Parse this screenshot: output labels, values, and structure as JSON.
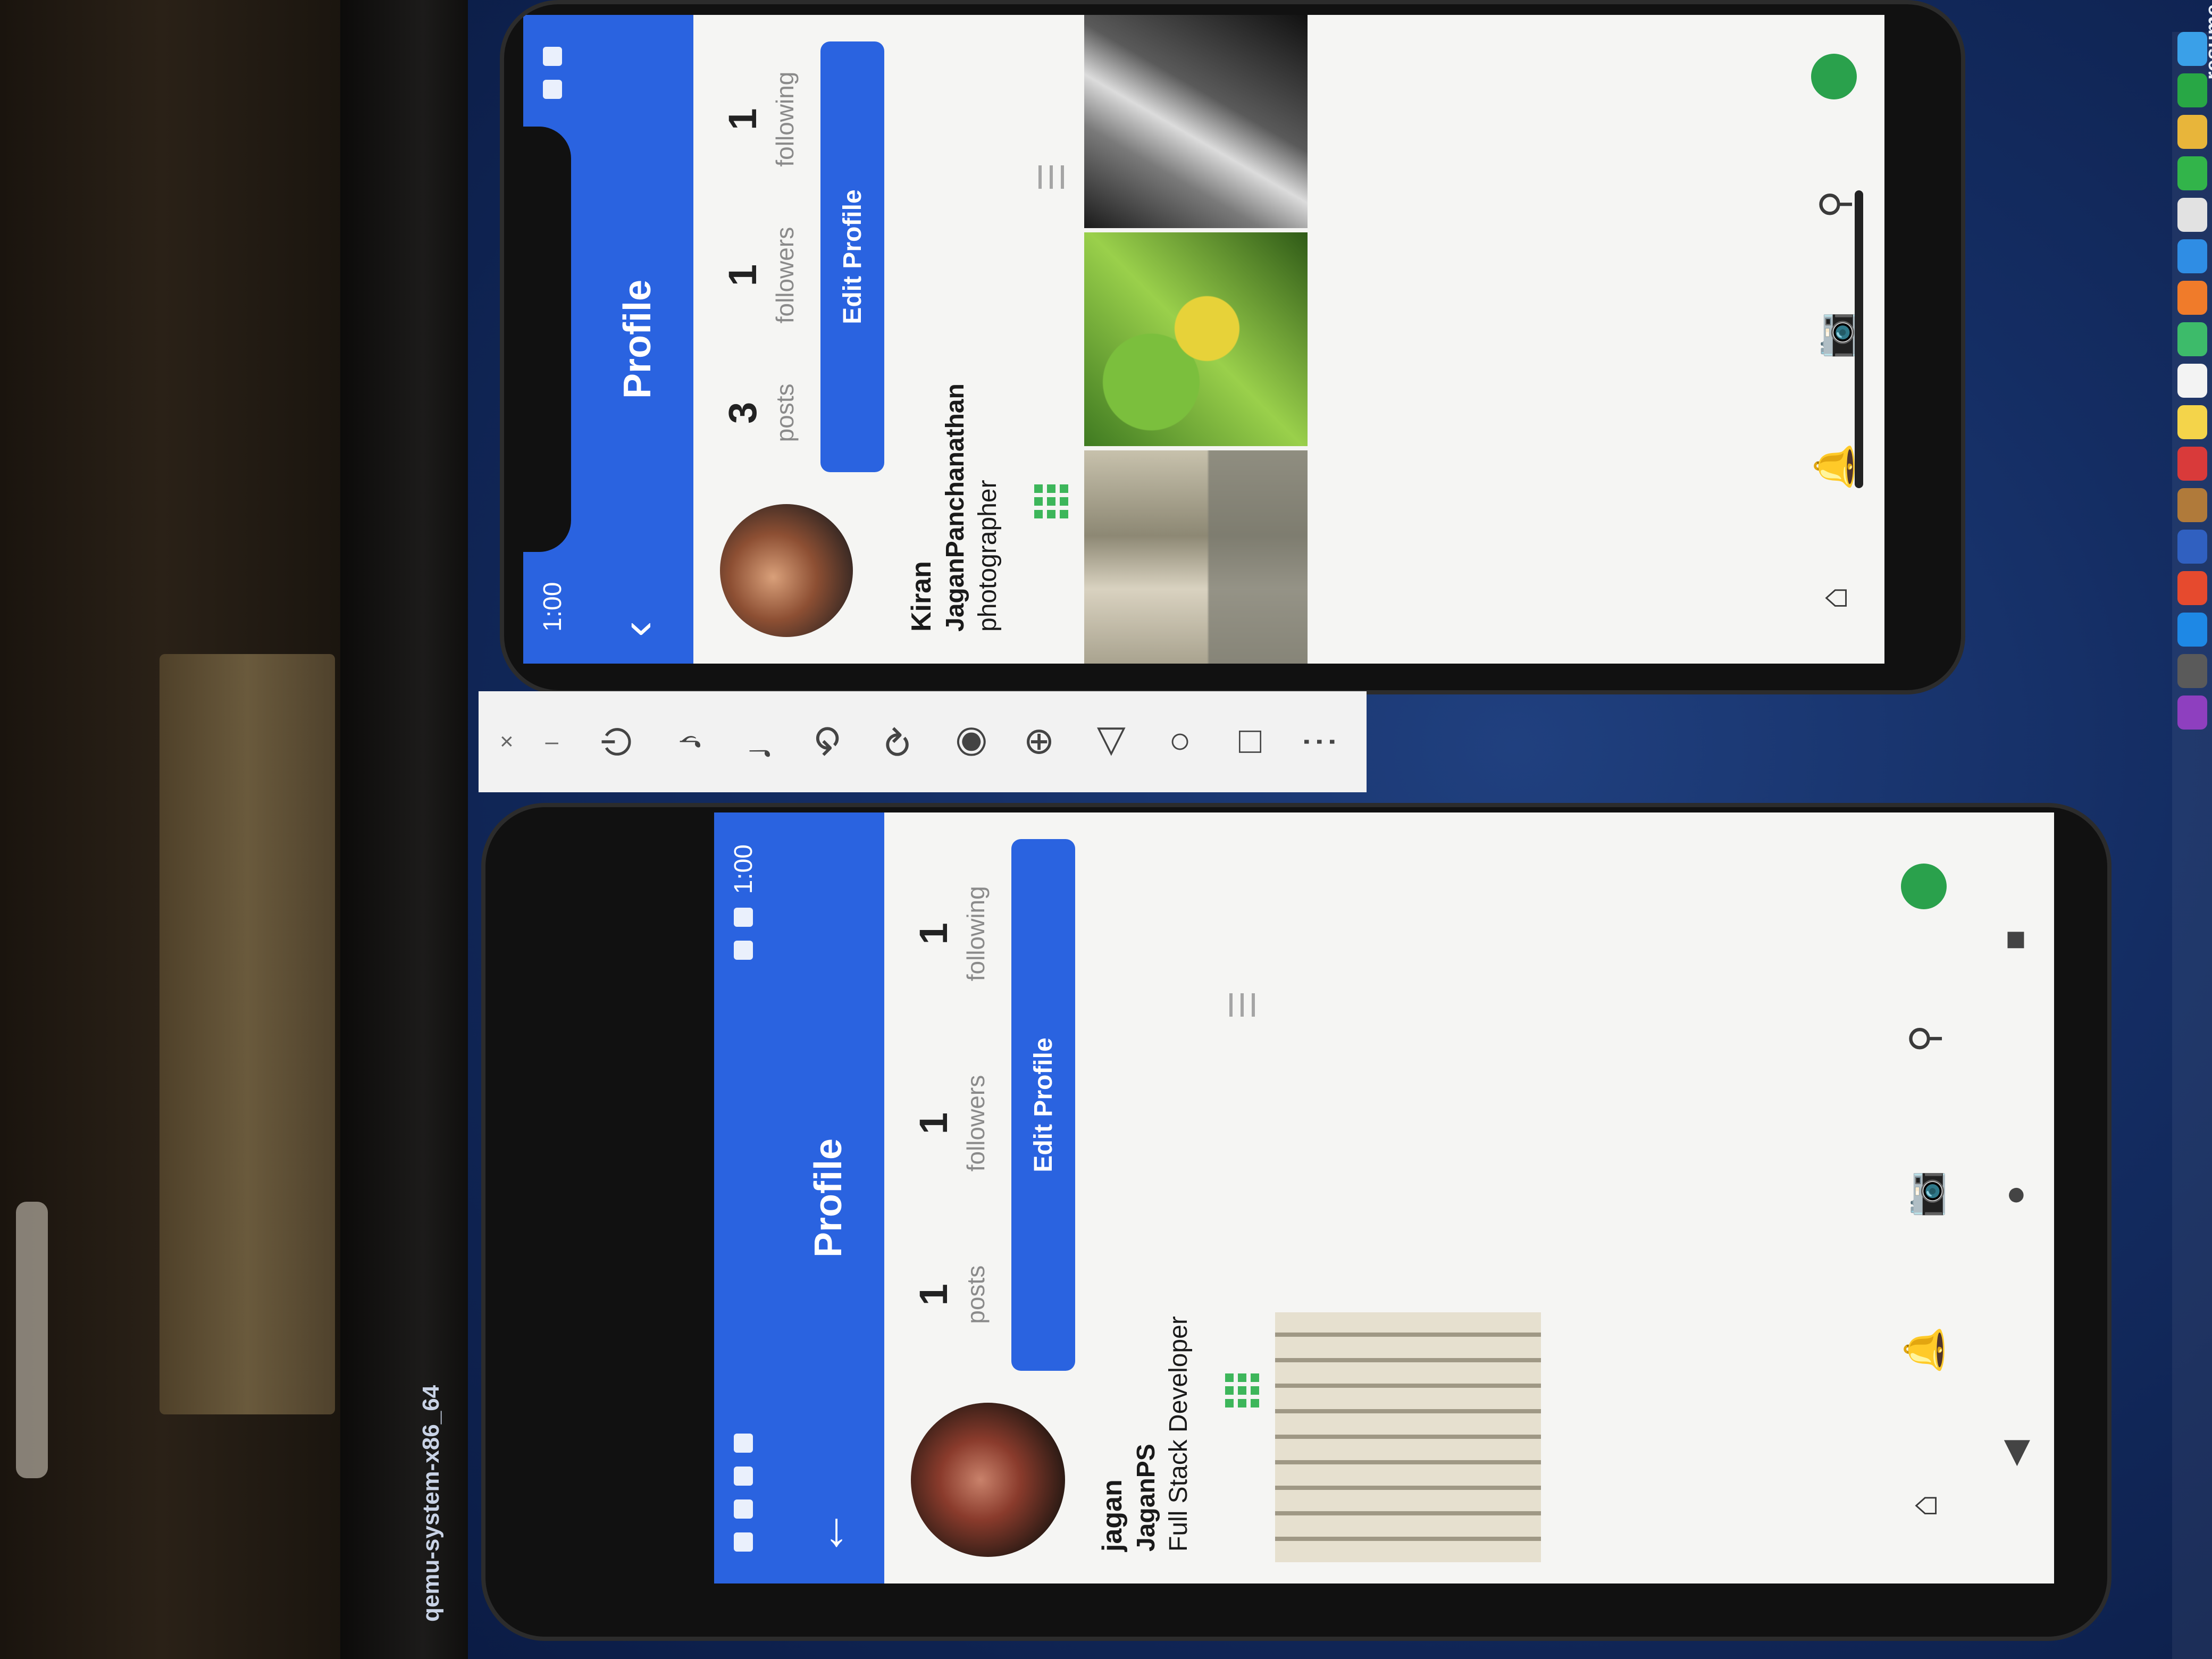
{
  "host": {
    "window_title": "qemu-system-x86_64",
    "desktop_label": "resume"
  },
  "emulator_toolbar": {
    "close": "×",
    "minimize": "–",
    "buttons": [
      "power-icon",
      "volume-up-icon",
      "volume-down-icon",
      "rotate-left-icon",
      "rotate-right-icon",
      "camera-icon",
      "zoom-icon",
      "back-icon",
      "home-icon",
      "overview-icon",
      "more-icon"
    ],
    "glyphs": [
      "⏻",
      "♪",
      "♩",
      "⟲",
      "⟳",
      "◉",
      "⊕",
      "◁",
      "○",
      "□",
      "⋮"
    ]
  },
  "phone_a": {
    "status": {
      "time": "1:00"
    },
    "appbar": {
      "title": "Profile",
      "back": "‹"
    },
    "profile": {
      "name": "Kiran",
      "username": "JaganPanchanathan",
      "bio": "photographer",
      "stats": [
        {
          "value": "3",
          "label": "posts"
        },
        {
          "value": "1",
          "label": "followers"
        },
        {
          "value": "1",
          "label": "following"
        }
      ],
      "edit_button": "Edit Profile"
    },
    "photos": [
      "hallway",
      "leaves",
      "waterfall"
    ]
  },
  "phone_b": {
    "status": {
      "time": "1:00"
    },
    "appbar": {
      "title": "Profile",
      "back": "←"
    },
    "profile": {
      "name": "jagan",
      "username": "JaganPS",
      "bio": "Full Stack Developer",
      "stats": [
        {
          "value": "1",
          "label": "posts"
        },
        {
          "value": "1",
          "label": "followers"
        },
        {
          "value": "1",
          "label": "following"
        }
      ],
      "edit_button": "Edit Profile"
    },
    "photos": [
      "hallway"
    ],
    "system_nav": {
      "back": "◀",
      "home": "●",
      "recents": "■"
    }
  },
  "bottom_nav_glyphs": {
    "home": "⌂",
    "notifications": "🔔",
    "camera": "📷",
    "search": "⚲"
  },
  "colors": {
    "app_blue": "#2a63e0",
    "accent_green": "#3db65a",
    "screen_bg": "#f5f5f3"
  }
}
